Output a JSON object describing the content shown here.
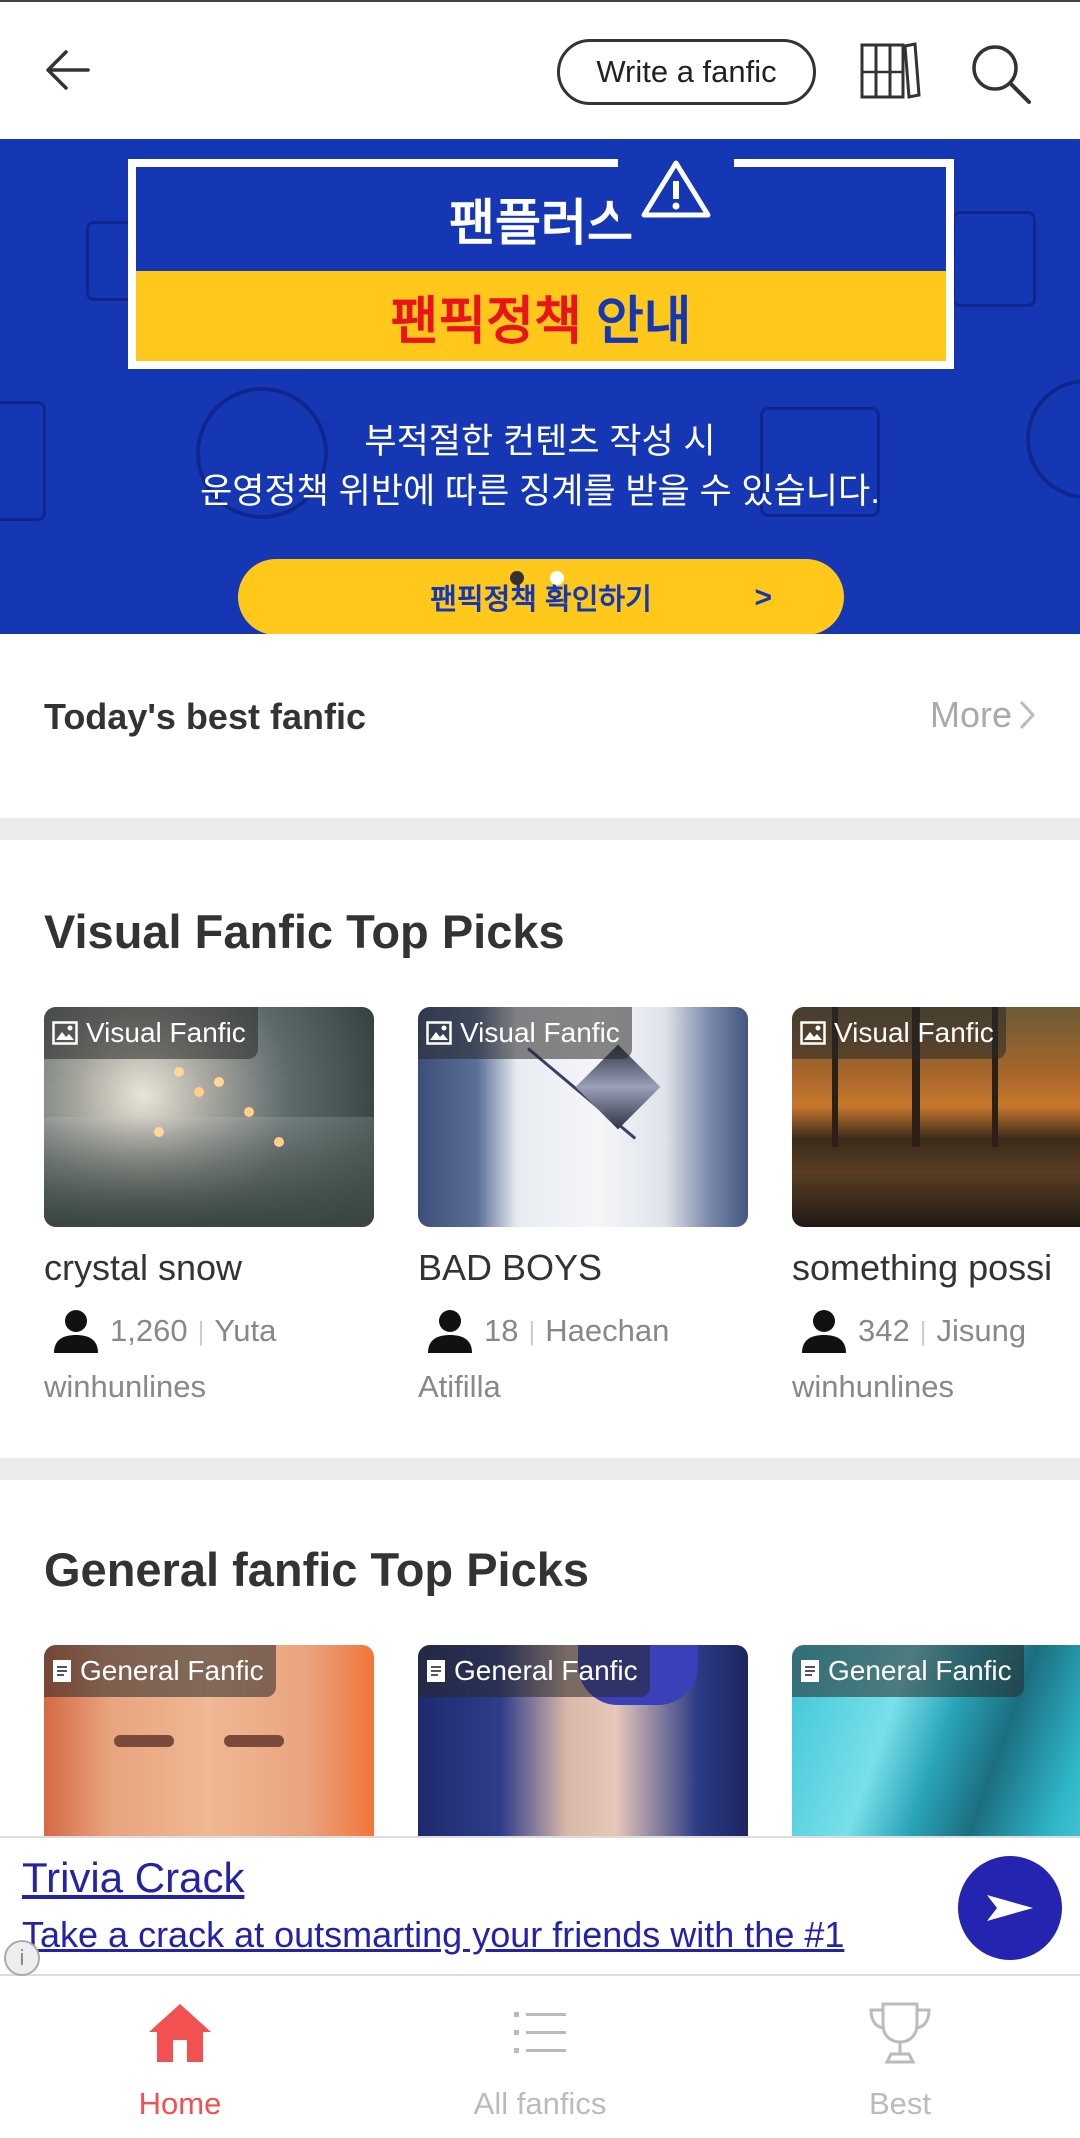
{
  "header": {
    "write_label": "Write a fanfic"
  },
  "banner": {
    "brand": "팬플러스",
    "title_red": "팬픽정책",
    "title_blue": "안내",
    "message_line1": "부적절한 컨텐츠 작성 시",
    "message_line2": "운영정책 위반에 따른 징계를 받을 수 있습니다.",
    "cta_label": "팬픽정책 확인하기",
    "cta_arrow": ">",
    "colors": {
      "background": "#1637b4",
      "yellow": "#ffc81a",
      "red": "#e8141c"
    }
  },
  "today": {
    "title": "Today's best fanfic",
    "more_label": "More"
  },
  "visual_section": {
    "title": "Visual Fanfic Top Picks",
    "cards": [
      {
        "tag": "Visual Fanfic",
        "title": "crystal snow",
        "count": "1,260",
        "member": "Yuta",
        "author": "winhunlines"
      },
      {
        "tag": "Visual Fanfic",
        "title": "BAD BOYS",
        "count": "18",
        "member": "Haechan",
        "author": "Atifilla"
      },
      {
        "tag": "Visual Fanfic",
        "title": "something possi",
        "count": "342",
        "member": "Jisung",
        "author": "winhunlines"
      }
    ]
  },
  "general_section": {
    "title": "General fanfic Top Picks",
    "cards": [
      {
        "tag": "General Fanfic"
      },
      {
        "tag": "General Fanfic"
      },
      {
        "tag": "General Fanfic"
      }
    ]
  },
  "ad": {
    "title": "Trivia Crack",
    "text": "Take a crack at outsmarting your friends with the #1",
    "info_icon": "i"
  },
  "bottom_nav": {
    "items": [
      {
        "label": "Home",
        "icon": "home-icon",
        "active": true
      },
      {
        "label": "All fanfics",
        "icon": "list-icon",
        "active": false
      },
      {
        "label": "Best",
        "icon": "trophy-icon",
        "active": false
      }
    ],
    "active_color": "#f15150"
  }
}
